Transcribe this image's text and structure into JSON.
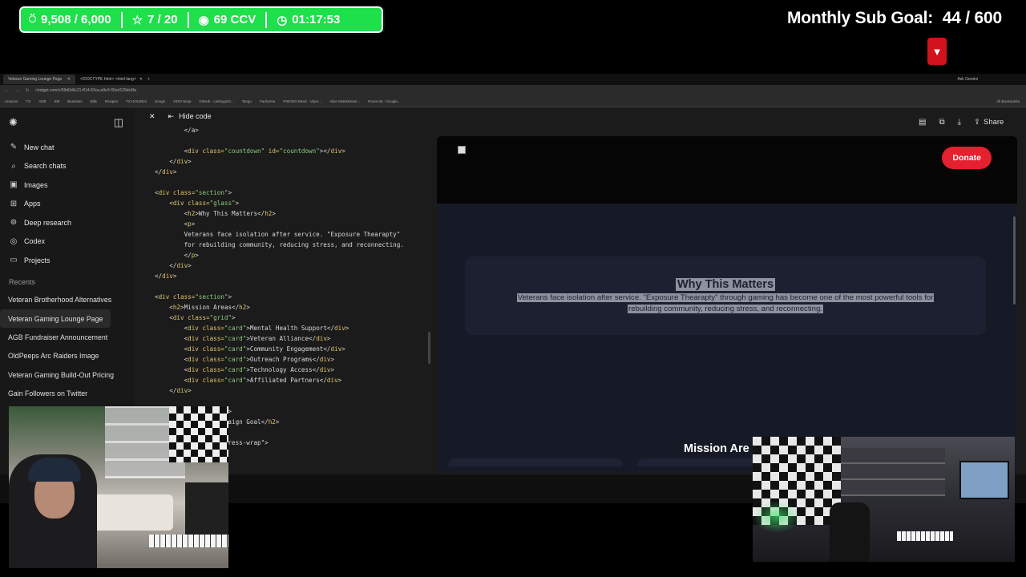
{
  "overlay": {
    "stats": [
      {
        "icon": "award-icon",
        "glyph": "⍥",
        "value": "9,508 / 6,000"
      },
      {
        "icon": "star-icon",
        "glyph": "☆",
        "value": "7 / 20"
      },
      {
        "icon": "eye-icon",
        "glyph": "◉",
        "value": "69 CCV"
      },
      {
        "icon": "timer-icon",
        "glyph": "◷",
        "value": "01:17:53"
      }
    ],
    "sub_goal_label": "Monthly Sub Goal:",
    "sub_goal_value": "44 / 600",
    "accent": "#1ee04b",
    "badge_color": "#d0131c"
  },
  "browser": {
    "tabs": [
      {
        "label": "Veteran Gaming Lounge Page",
        "active": true
      },
      {
        "label": "<!DOCTYPE html> <html lang>",
        "active": false
      }
    ],
    "account": "Ask Gemini",
    "url": "chatgpt.com/c/69d0d6c21-ff14-83ca-a9e3-65ed129dc6fa",
    "bookmarks": [
      "Amazon",
      "TX",
      "ADB",
      "SM",
      "Business",
      "Bills",
      "Recipes",
      "TX HOUSES",
      "Songs",
      "VIDO Ninja",
      "GitHub - LinDogo/O...",
      "Tango",
      "Fanforme",
      "PSE/WS Basic - Vipre...",
      "Alive Multistream...",
      "Route 66 - Google..."
    ],
    "all_bookmarks": "All Bookmarks"
  },
  "sidebar": {
    "items": [
      {
        "icon": "pencil-icon",
        "glyph": "✎",
        "label": "New chat"
      },
      {
        "icon": "search-icon",
        "glyph": "⌕",
        "label": "Search chats"
      },
      {
        "icon": "image-icon",
        "glyph": "▣",
        "label": "Images"
      },
      {
        "icon": "apps-icon",
        "glyph": "⊞",
        "label": "Apps"
      },
      {
        "icon": "research-icon",
        "glyph": "⊚",
        "label": "Deep research"
      },
      {
        "icon": "codex-icon",
        "glyph": "◎",
        "label": "Codex"
      },
      {
        "icon": "folder-icon",
        "glyph": "▭",
        "label": "Projects"
      }
    ],
    "recents_label": "Recents",
    "recents": [
      "Veteran Brotherhood Alternatives",
      "Veteran Gaming Lounge Page",
      "AGB Fundraiser Announcement",
      "OldPeeps Arc Raiders Image",
      "Veteran Gaming Build-Out Pricing",
      "Gain Followers on Twitter"
    ],
    "active_recent": 1
  },
  "code_pane": {
    "hide_label": "Hide code"
  },
  "preview": {
    "toolbar_share": "Share",
    "donate": "Donate",
    "section_title": "Why This Matters",
    "section_text_1": "Veterans face isolation after service. \"Exposure Thearapty\" through gaming has become one of the most powerful tools for",
    "section_text_2": "rebuilding community, reducing stress, and reconnecting.",
    "mission_title": "Mission Are",
    "donate_color": "#e5202f"
  }
}
